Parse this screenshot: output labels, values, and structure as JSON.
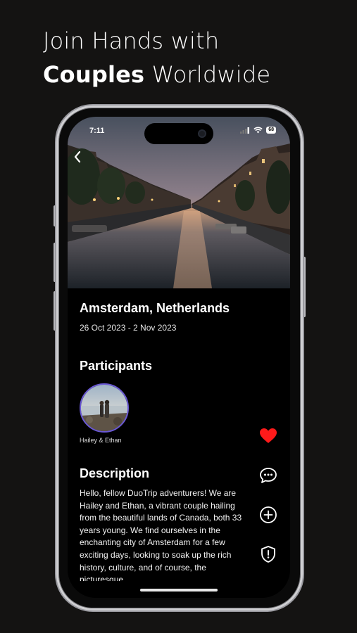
{
  "promo": {
    "line1": "Join Hands with",
    "line2_bold": "Couples",
    "line2_rest": " Worldwide"
  },
  "status_bar": {
    "time": "7:11",
    "battery": "68"
  },
  "trip": {
    "place": "Amsterdam, Netherlands",
    "dates": "26 Oct 2023 - 2 Nov 2023"
  },
  "participants": {
    "heading": "Participants",
    "items": [
      {
        "name": "Hailey & Ethan"
      }
    ]
  },
  "description": {
    "heading": "Description",
    "text": "Hello, fellow DuoTrip adventurers! We are Hailey and Ethan, a vibrant couple hailing from the beautiful lands of Canada, both 33 years young. We find ourselves in the enchanting city of Amsterdam for a few exciting days, looking to soak up the rich history, culture, and of course, the picturesque"
  },
  "actions": [
    {
      "icon": "heart-icon",
      "color": "#ff1a1a"
    },
    {
      "icon": "chat-icon",
      "color": "#ffffff"
    },
    {
      "icon": "plus-circle-icon",
      "color": "#ffffff"
    },
    {
      "icon": "shield-alert-icon",
      "color": "#ffffff"
    }
  ]
}
